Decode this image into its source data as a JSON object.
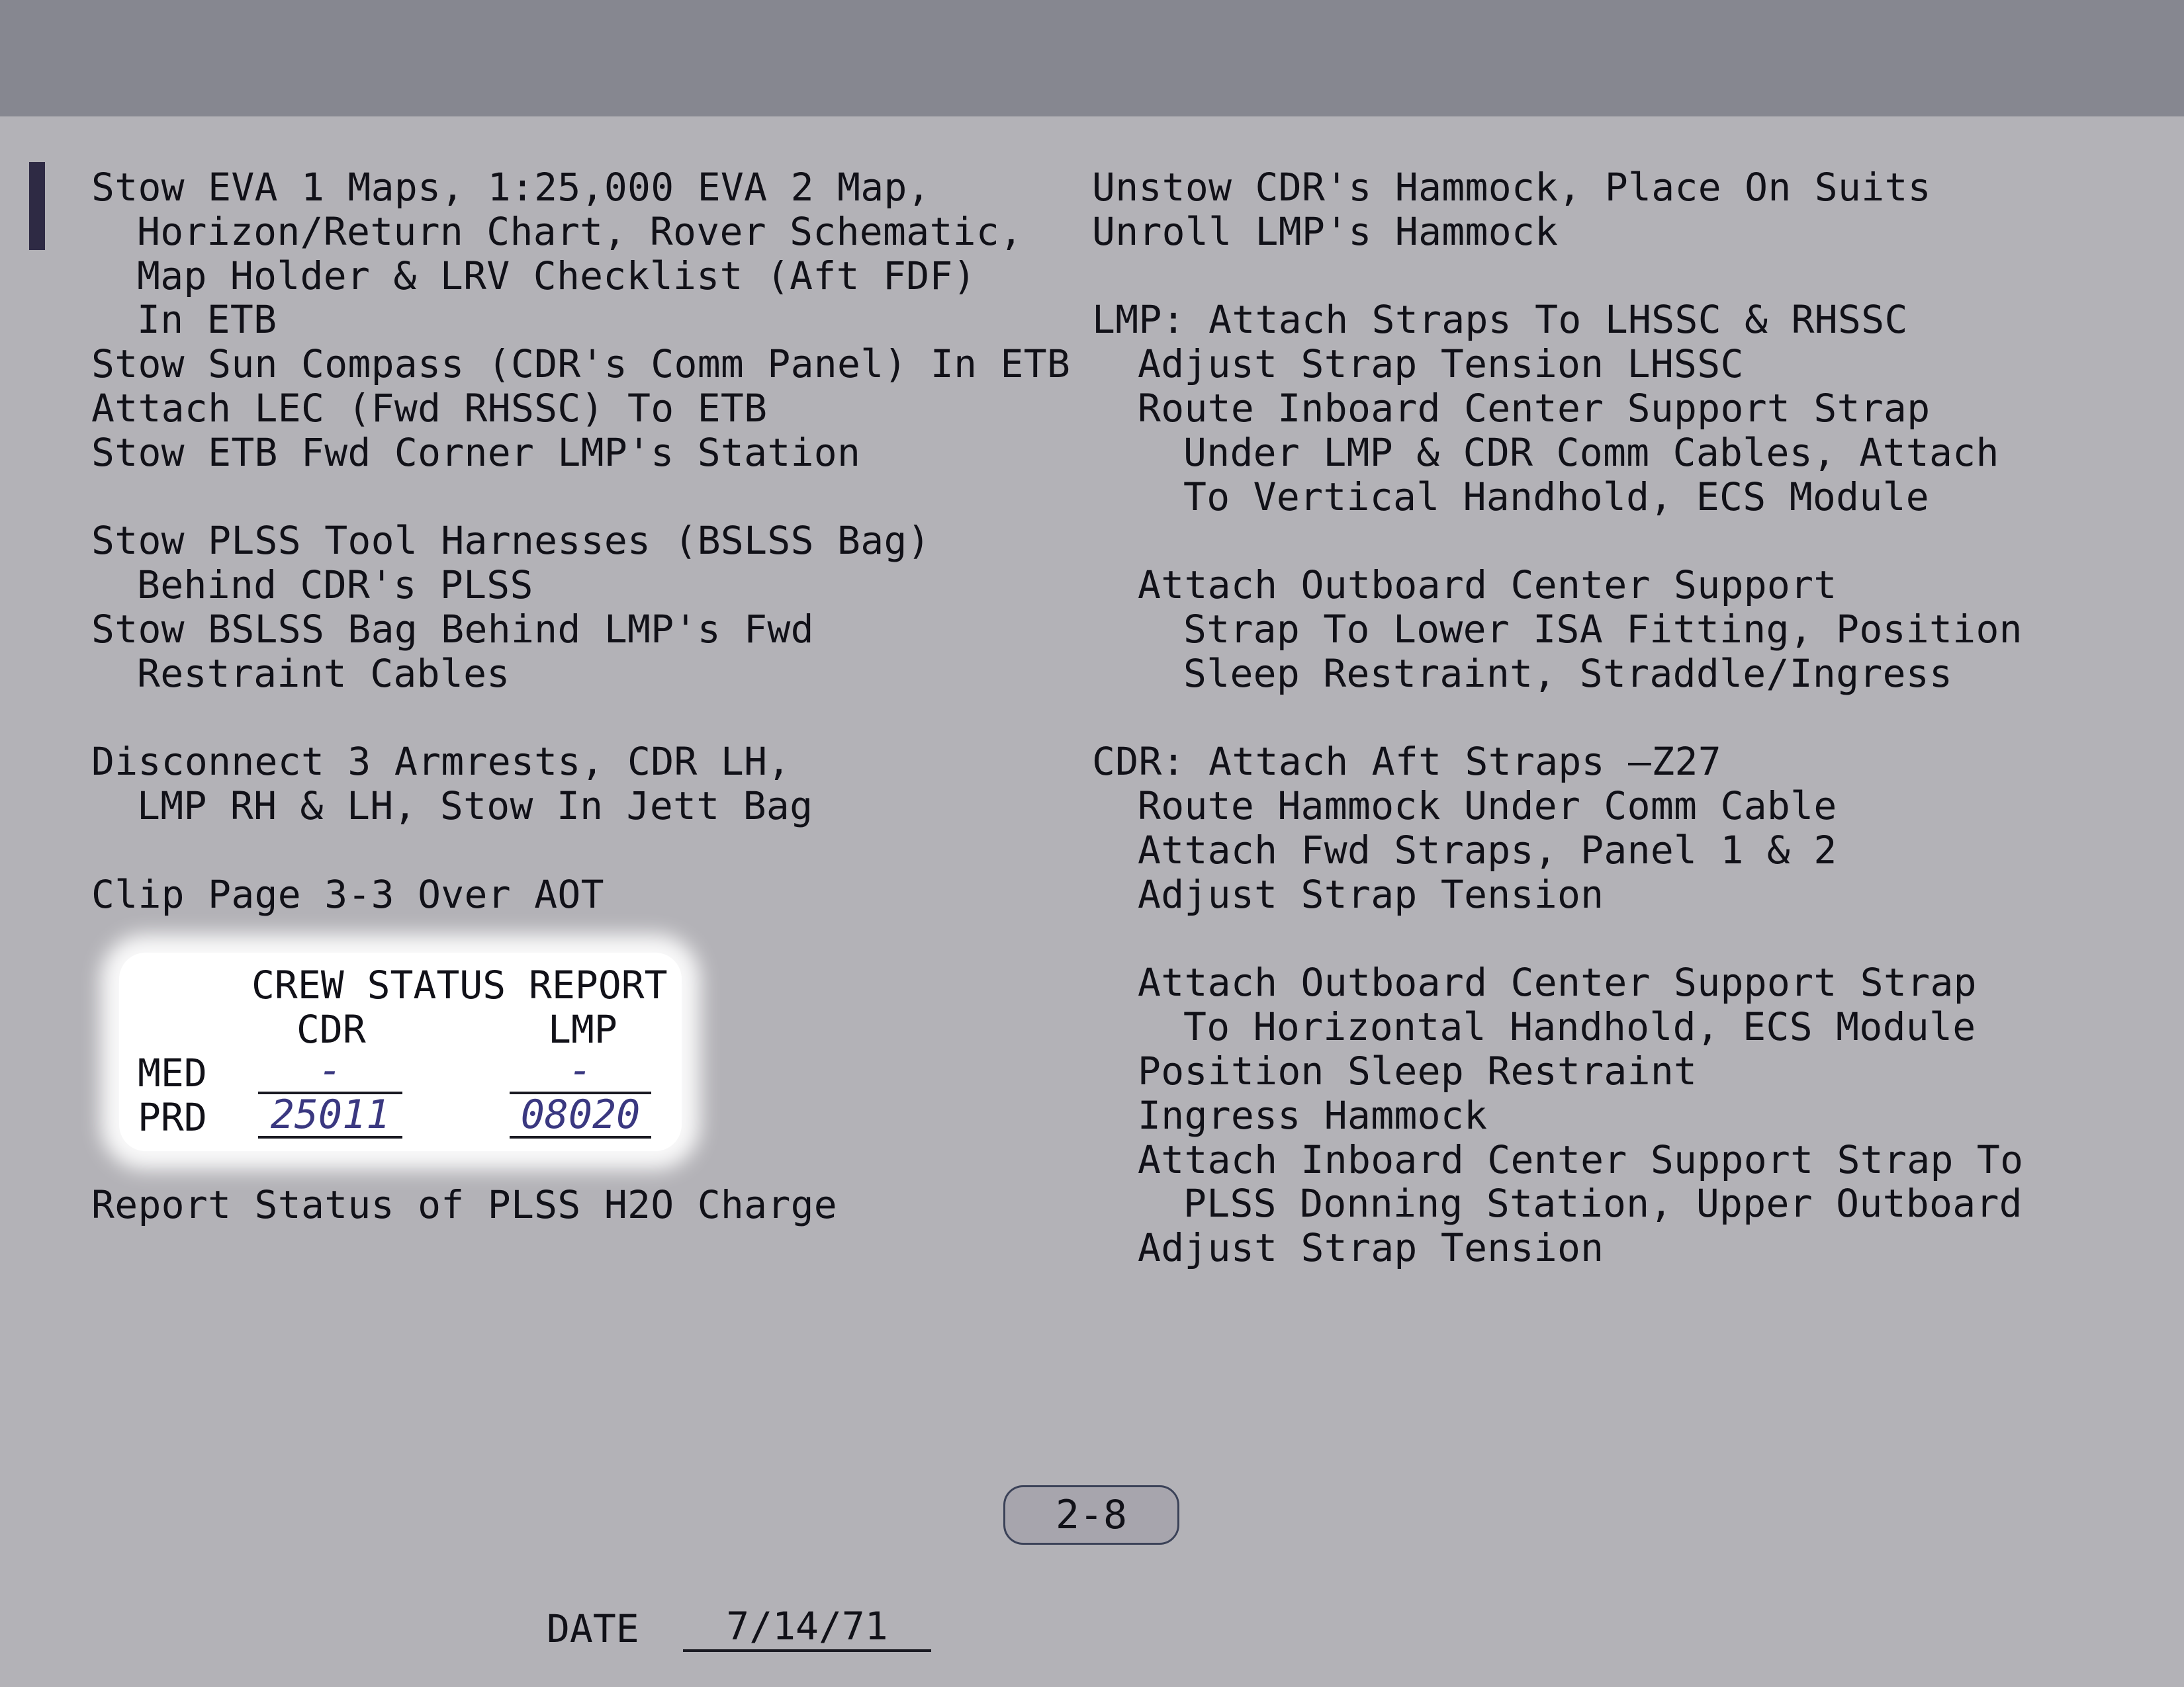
{
  "left_column": [
    {
      "text": "Stow EVA 1 Maps, 1:25,000 EVA 2 Map,",
      "indent": 0
    },
    {
      "text": "Horizon/Return Chart, Rover Schematic,",
      "indent": 1
    },
    {
      "text": "Map Holder & LRV Checklist (Aft FDF)",
      "indent": 1
    },
    {
      "text": "In ETB",
      "indent": 1
    },
    {
      "text": "Stow Sun Compass (CDR's Comm Panel) In ETB",
      "indent": 0
    },
    {
      "text": "Attach LEC (Fwd RHSSC) To ETB",
      "indent": 0
    },
    {
      "text": "Stow ETB Fwd Corner LMP's Station",
      "indent": 0
    },
    {
      "text": "",
      "indent": 0
    },
    {
      "text": "Stow PLSS Tool Harnesses (BSLSS Bag)",
      "indent": 0
    },
    {
      "text": "Behind CDR's PLSS",
      "indent": 1
    },
    {
      "text": "Stow BSLSS Bag Behind LMP's Fwd",
      "indent": 0
    },
    {
      "text": "Restraint Cables",
      "indent": 1
    },
    {
      "text": "",
      "indent": 0
    },
    {
      "text": "Disconnect 3 Armrests, CDR LH,",
      "indent": 0
    },
    {
      "text": "LMP RH & LH, Stow In Jett Bag",
      "indent": 1
    },
    {
      "text": "",
      "indent": 0
    },
    {
      "text": "Clip Page 3-3 Over AOT",
      "indent": 0
    }
  ],
  "crew_status": {
    "title": "CREW STATUS REPORT",
    "cdr_label": "CDR",
    "lmp_label": "LMP",
    "med_label": "MED",
    "prd_label": "PRD",
    "cdr_med": "-",
    "lmp_med": "-",
    "cdr_prd": "25011",
    "lmp_prd": "08020"
  },
  "left_footer": "Report Status of PLSS H2O Charge",
  "right_column": [
    {
      "text": "Unstow CDR's Hammock, Place On Suits",
      "indent": 0
    },
    {
      "text": "Unroll LMP's Hammock",
      "indent": 0
    },
    {
      "text": "",
      "indent": 0
    },
    {
      "text": "LMP: Attach Straps To LHSSC & RHSSC",
      "indent": 0
    },
    {
      "text": "Adjust Strap Tension LHSSC",
      "indent": 1
    },
    {
      "text": "Route Inboard Center Support Strap",
      "indent": 1
    },
    {
      "text": "Under LMP & CDR Comm Cables, Attach",
      "indent": 2
    },
    {
      "text": "To Vertical Handhold, ECS Module",
      "indent": 2
    },
    {
      "text": "",
      "indent": 0
    },
    {
      "text": "Attach Outboard Center Support",
      "indent": 1
    },
    {
      "text": "Strap To Lower ISA Fitting, Position",
      "indent": 2
    },
    {
      "text": "Sleep Restraint, Straddle/Ingress",
      "indent": 2
    },
    {
      "text": "",
      "indent": 0
    },
    {
      "text": "CDR: Attach Aft Straps —Z27",
      "indent": 0
    },
    {
      "text": "Route Hammock Under Comm Cable",
      "indent": 1
    },
    {
      "text": "Attach Fwd Straps, Panel 1 & 2",
      "indent": 1
    },
    {
      "text": "Adjust Strap Tension",
      "indent": 1
    },
    {
      "text": "",
      "indent": 0
    },
    {
      "text": "Attach Outboard Center Support Strap",
      "indent": 1
    },
    {
      "text": "To Horizontal Handhold, ECS Module",
      "indent": 2
    },
    {
      "text": "Position Sleep Restraint",
      "indent": 1
    },
    {
      "text": "Ingress Hammock",
      "indent": 1
    },
    {
      "text": "Attach Inboard Center Support Strap To",
      "indent": 1
    },
    {
      "text": "PLSS Donning Station, Upper Outboard",
      "indent": 2
    },
    {
      "text": "Adjust Strap Tension",
      "indent": 1
    }
  ],
  "page_number": "2-8",
  "date_label": "DATE",
  "date_value": "7/14/71"
}
